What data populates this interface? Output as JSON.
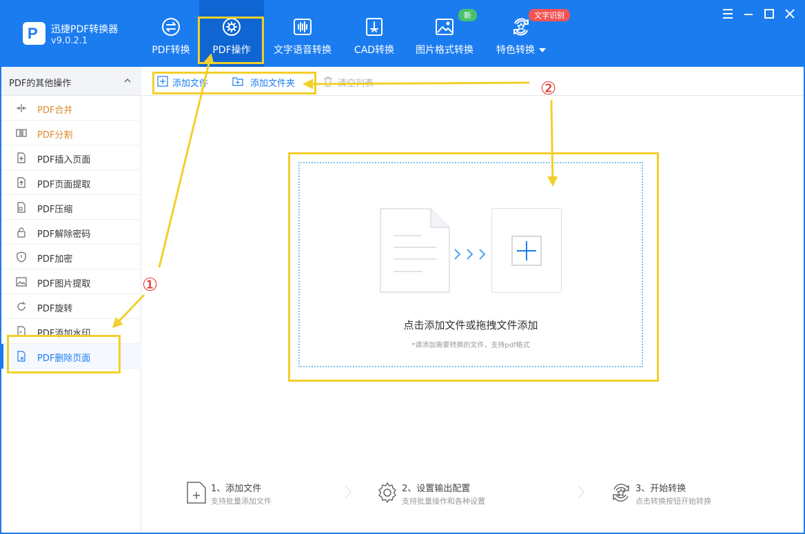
{
  "app": {
    "name": "迅捷PDF转换器",
    "version": "v9.0.2.1",
    "logo_letter": "P"
  },
  "nav": [
    {
      "label": "PDF转换",
      "icon": "swap-circle-icon"
    },
    {
      "label": "PDF操作",
      "icon": "gear-circle-icon",
      "active": true
    },
    {
      "label": "文字语音转换",
      "icon": "soundwave-icon"
    },
    {
      "label": "CAD转换",
      "icon": "cad-icon"
    },
    {
      "label": "图片格式转换",
      "icon": "image-icon"
    },
    {
      "label": "特色转换",
      "icon": "star-refresh-icon"
    }
  ],
  "badges": {
    "new": "新",
    "ocr": "文字识别"
  },
  "sidebar": {
    "header": "PDF的其他操作",
    "items": [
      {
        "label": "PDF合并",
        "icon": "merge-icon"
      },
      {
        "label": "PDF分割",
        "icon": "split-icon"
      },
      {
        "label": "PDF插入页面",
        "icon": "insert-page-icon"
      },
      {
        "label": "PDF页面提取",
        "icon": "extract-page-icon"
      },
      {
        "label": "PDF压缩",
        "icon": "compress-icon"
      },
      {
        "label": "PDF解除密码",
        "icon": "unlock-icon"
      },
      {
        "label": "PDF加密",
        "icon": "shield-icon"
      },
      {
        "label": "PDF图片提取",
        "icon": "image-extract-icon"
      },
      {
        "label": "PDF旋转",
        "icon": "rotate-icon"
      },
      {
        "label": "PDF添加水印",
        "icon": "watermark-icon"
      },
      {
        "label": "PDF删除页面",
        "icon": "delete-page-icon"
      }
    ]
  },
  "toolbar": {
    "add_file": "添加文件",
    "add_folder": "添加文件夹",
    "clear_list": "清空列表"
  },
  "dropzone": {
    "title": "点击添加文件或拖拽文件添加",
    "subtitle": "*请添加需要转换的文件，支持pdf格式"
  },
  "steps": [
    {
      "title": "1、添加文件",
      "sub": "支持批量添加文件"
    },
    {
      "title": "2、设置输出配置",
      "sub": "支持批量操作和各种设置"
    },
    {
      "title": "3、开始转换",
      "sub": "点击转换按钮开始转换"
    }
  ],
  "annotations": {
    "marker1": "①",
    "marker2": "②"
  },
  "colors": {
    "primary": "#1b7cf0",
    "highlight": "#f2cf2a",
    "marker": "#e62e2e",
    "accent_orange": "#d98a2d"
  }
}
